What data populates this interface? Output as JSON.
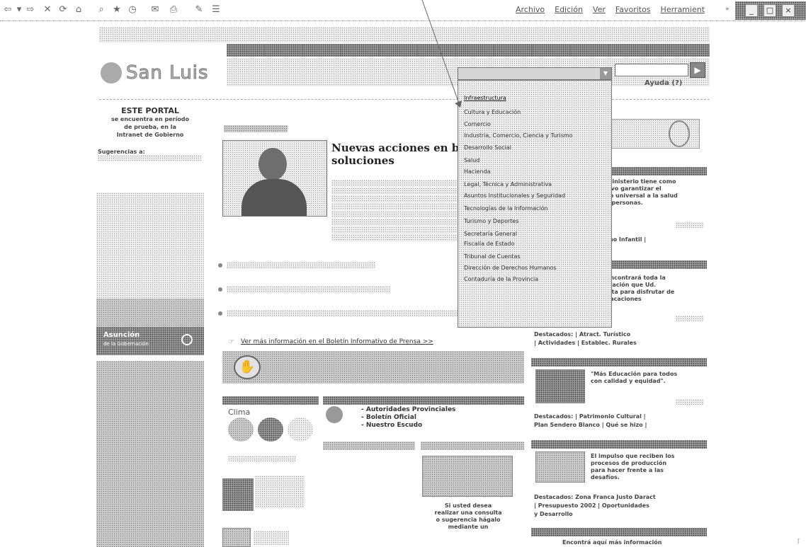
{
  "browser": {
    "menu": [
      "Archivo",
      "Edición",
      "Ver",
      "Favoritos",
      "Herramient"
    ],
    "menu_more": "»",
    "toolbar_icons": [
      "back-icon",
      "forward-icon",
      "stop-icon",
      "refresh-icon",
      "home-icon",
      "search-icon",
      "favorites-icon",
      "history-icon",
      "mail-icon",
      "print-icon",
      "edit-icon",
      "discuss-icon"
    ],
    "toolbar_glyphs": [
      "⇦",
      "▾",
      "⇨",
      "✕",
      "⟳",
      "⌂",
      "⌕",
      "★",
      "◷",
      "✉",
      "⎙",
      "✎",
      "☰"
    ]
  },
  "site": {
    "logo": "San Luis",
    "help_label": "Ayuda (?)",
    "search_button": "▶"
  },
  "left": {
    "notice_title": "ESTE PORTAL",
    "notice_body": [
      "se encuentra en período",
      "de prueba, en la",
      "Intranet de Gobierno"
    ],
    "suggestions_label": "Sugerencias a:",
    "banner_title": "Asunción",
    "banner_sub": "de la Gobernación"
  },
  "main": {
    "headline": "Nuevas acciones en bu soluciones",
    "more_link": "Ver más información en el Boletín Informativo de Prensa >>",
    "clima_label": "Clima",
    "links": [
      "- Autoridades Provinciales",
      "- Boletín Oficial",
      "- Nuestro Escudo"
    ],
    "consult_text": [
      "Si usted desea",
      "realizar una consulta",
      "o sugerencia hágalo",
      "mediante un"
    ]
  },
  "right": {
    "box1_text": [
      "ministerio tiene como",
      "tivo garantizar el",
      "so universal a la salud",
      "s personas."
    ],
    "box1_extra": "rno Infantil |",
    "box2_text": [
      "encontrará toda la",
      "mación que Ud.",
      "sita para disfrutar de",
      "vacaciones"
    ],
    "box2_links_1": "Destacados: | Atract. Turístico",
    "box2_links_2": "| Actividades | Establec. Rurales",
    "box3_text": [
      "\"Más Educación para todos",
      "con calidad y equidad\"."
    ],
    "box3_links_1": "Destacados: | Patrimonio Cultural |",
    "box3_links_2": "Plan Sendero Blanco | Qué se hizo |",
    "box4_text": [
      "El impulso que reciben los",
      "procesos de producción",
      "para hacer frente a las",
      "desafíos."
    ],
    "box4_links_1": "Destacados: Zona Franca Justo Daract",
    "box4_links_2": "| Presupuesto 2002 | Oportunidades",
    "box4_links_3": "y Desarrollo",
    "box5_text": "Encontrá aquí más información"
  },
  "dropdown": {
    "options": [
      "Infraestructura",
      "Cultura y Educación",
      "Comercio",
      "Industria, Comercio, Ciencia y Turismo",
      "Desarrollo Social",
      "Salud",
      "Hacienda",
      "Legal, Técnica y Administrativa",
      "Asuntos Institucionales y Seguridad",
      "Tecnologías de la Información",
      "Turismo y Deportes",
      "Secretaría General",
      "Fiscalía de Estado",
      "Tribunal de Cuentas",
      "Dirección de Derechos Humanos",
      "Contaduría de la Provincia"
    ],
    "selected_index": 0
  }
}
